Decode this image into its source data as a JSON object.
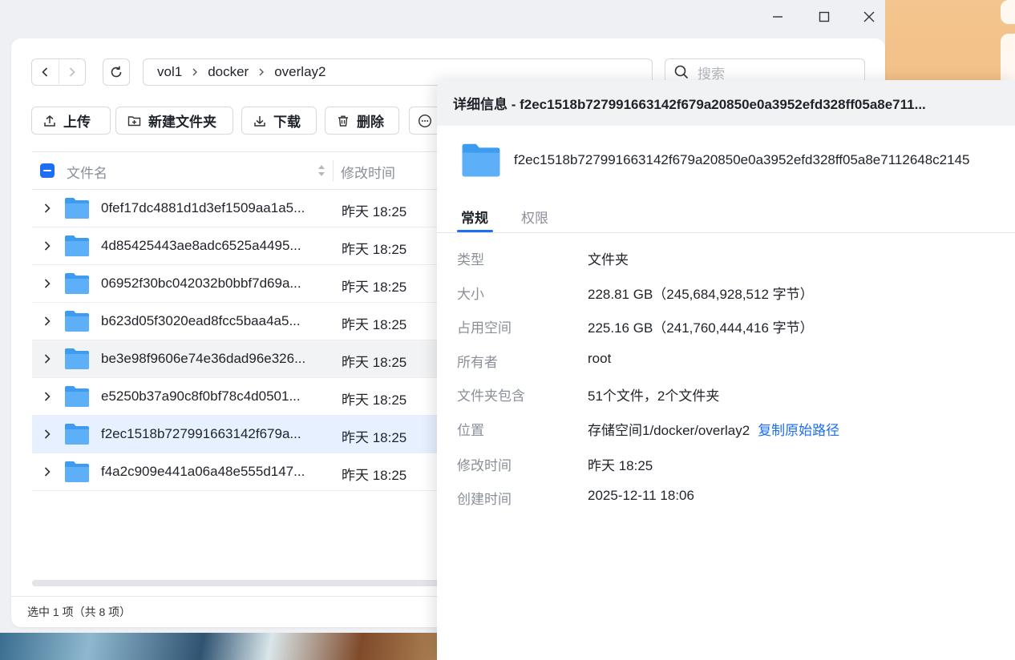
{
  "toolbar": {
    "path": [
      "vol1",
      "docker",
      "overlay2"
    ],
    "search_placeholder": "搜索",
    "buttons": {
      "upload": "上传",
      "new_folder": "新建文件夹",
      "download": "下载",
      "delete": "删除"
    }
  },
  "table": {
    "col_name": "文件名",
    "col_modified": "修改时间",
    "rows": [
      {
        "name": "0fef17dc4881d1d3ef1509aa1a5...",
        "modified": "昨天 18:25"
      },
      {
        "name": "4d85425443ae8adc6525a4495...",
        "modified": "昨天 18:25"
      },
      {
        "name": "06952f30bc042032b0bbf7d69a...",
        "modified": "昨天 18:25"
      },
      {
        "name": "b623d05f3020ead8fcc5baa4a5...",
        "modified": "昨天 18:25"
      },
      {
        "name": "be3e98f9606e74e36dad96e326...",
        "modified": "昨天 18:25"
      },
      {
        "name": "e5250b37a90c8f0bf78c4d0501...",
        "modified": "昨天 18:25"
      },
      {
        "name": "f2ec1518b727991663142f679a...",
        "modified": "昨天 18:25"
      },
      {
        "name": "f4a2c909e441a06a48e555d147...",
        "modified": "昨天 18:25"
      }
    ]
  },
  "status": "选中 1 项（共 8 项）",
  "detail": {
    "title": "详细信息 - f2ec1518b727991663142f679a20850e0a3952efd328ff05a8e711...",
    "folder_name": "f2ec1518b727991663142f679a20850e0a3952efd328ff05a8e7112648c2145",
    "tab_general": "常规",
    "tab_permissions": "权限",
    "props": {
      "type_label": "类型",
      "type_value": "文件夹",
      "size_label": "大小",
      "size_value": "228.81 GB（245,684,928,512 字节）",
      "used_label": "占用空间",
      "used_value": "225.16 GB（241,760,444,416 字节）",
      "owner_label": "所有者",
      "owner_value": "root",
      "contains_label": "文件夹包含",
      "contains_value": "51个文件，2个文件夹",
      "location_label": "位置",
      "location_value": "存储空间1/docker/overlay2",
      "copy_path": "复制原始路径",
      "modified_label": "修改时间",
      "modified_value": "昨天 18:25",
      "created_label": "创建时间",
      "created_value": "2025-12-11 18:06"
    }
  },
  "colors": {
    "accent": "#1c6ef2",
    "folder": "#3d9bf0",
    "selected_row": "#e7f0ff"
  }
}
